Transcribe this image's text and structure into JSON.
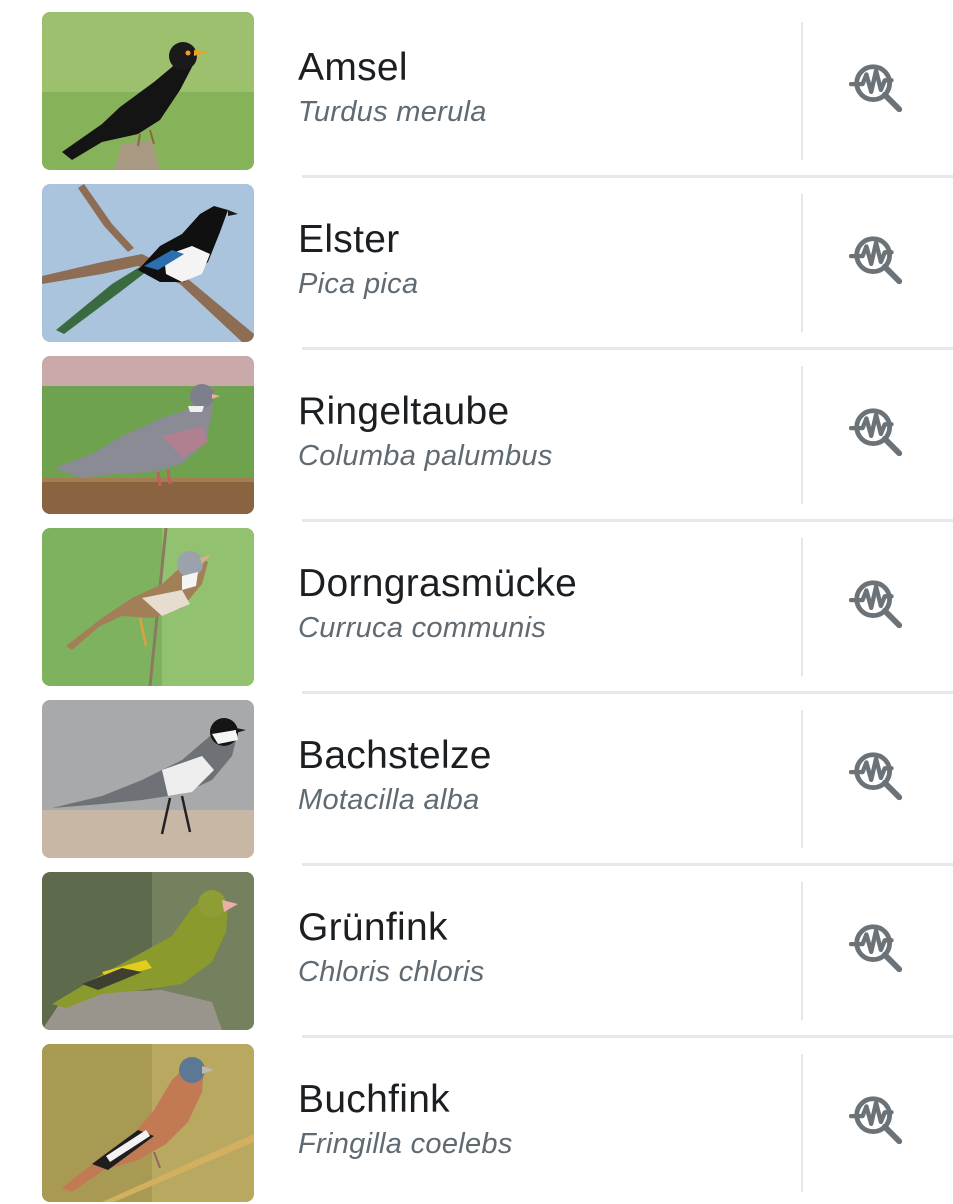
{
  "colors": {
    "title": "#1c1f22",
    "subtitle": "#5f6a72",
    "icon": "#6b7378",
    "divider": "#e6e8ea"
  },
  "species": [
    {
      "common_name": "Amsel",
      "latin_name": "Turdus merula",
      "icon": "sonogram-search-icon"
    },
    {
      "common_name": "Elster",
      "latin_name": "Pica pica",
      "icon": "sonogram-search-icon"
    },
    {
      "common_name": "Ringeltaube",
      "latin_name": "Columba palumbus",
      "icon": "sonogram-search-icon"
    },
    {
      "common_name": "Dorngrasmücke",
      "latin_name": "Curruca communis",
      "icon": "sonogram-search-icon"
    },
    {
      "common_name": "Bachstelze",
      "latin_name": "Motacilla alba",
      "icon": "sonogram-search-icon"
    },
    {
      "common_name": "Grünfink",
      "latin_name": "Chloris chloris",
      "icon": "sonogram-search-icon"
    },
    {
      "common_name": "Buchfink",
      "latin_name": "Fringilla coelebs",
      "icon": "sonogram-search-icon"
    }
  ]
}
